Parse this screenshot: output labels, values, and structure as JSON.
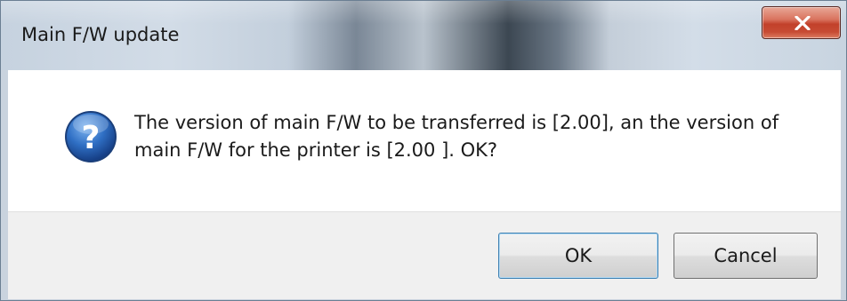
{
  "window": {
    "title": "Main F/W update"
  },
  "titlebar": {
    "close_icon": "close-icon"
  },
  "dialog": {
    "icon": "question-icon",
    "message_line1": "The version of main F/W to be transferred is [2.00], an the version of",
    "message_line2": "main F/W for the printer is [2.00 ]. OK?"
  },
  "buttons": {
    "ok_label": "OK",
    "cancel_label": "Cancel"
  },
  "colors": {
    "close_button": "#c74b33",
    "question_icon": "#1f5fb0",
    "ok_focus_border": "#3c7fb1"
  }
}
